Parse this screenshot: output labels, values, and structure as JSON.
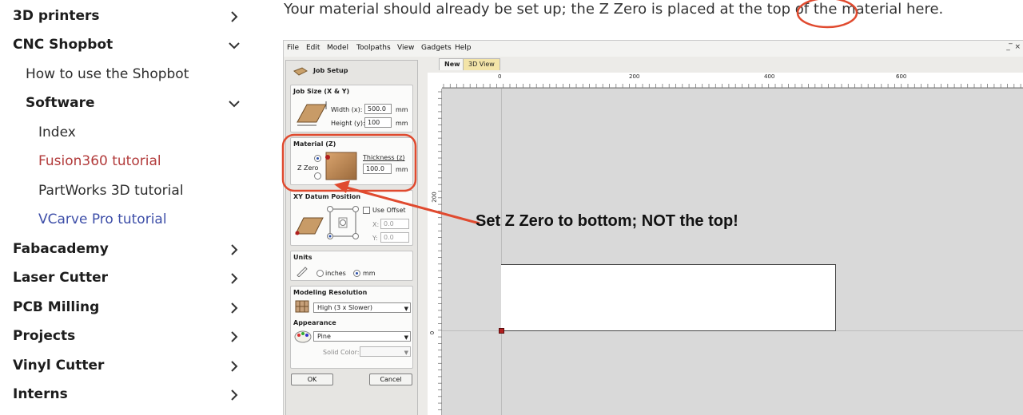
{
  "sidebar": {
    "items": [
      {
        "label": "3D printers",
        "chevron": "chevron-right-icon"
      },
      {
        "label": "CNC Shopbot",
        "chevron": "chevron-down-icon"
      },
      {
        "label": "How to use the Shopbot"
      },
      {
        "label": "Software",
        "chevron": "chevron-down-icon"
      },
      {
        "label": "Index"
      },
      {
        "label": "Fusion360 tutorial"
      },
      {
        "label": "PartWorks 3D tutorial"
      },
      {
        "label": "VCarve Pro tutorial"
      },
      {
        "label": "Fabacademy",
        "chevron": "chevron-right-icon"
      },
      {
        "label": "Laser Cutter",
        "chevron": "chevron-right-icon"
      },
      {
        "label": "PCB Milling",
        "chevron": "chevron-right-icon"
      },
      {
        "label": "Projects",
        "chevron": "chevron-right-icon"
      },
      {
        "label": "Vinyl Cutter",
        "chevron": "chevron-right-icon"
      },
      {
        "label": "Interns",
        "chevron": "chevron-right-icon"
      }
    ]
  },
  "content": {
    "intro": "Your material should already be set up; the Z Zero is placed at the top of the material here."
  },
  "app": {
    "menu": [
      "File",
      "Edit",
      "Model",
      "Toolpaths",
      "View",
      "Gadgets",
      "Help"
    ],
    "window_controls": "_ ̅ ×",
    "tabs": {
      "new": "New",
      "view3d": "3D View"
    },
    "panel": {
      "title": "Job Setup",
      "job_size": {
        "title": "Job Size (X & Y)",
        "width_label": "Width (x):",
        "width_value": "500.0",
        "height_label": "Height (y):",
        "height_value": "100",
        "unit": "mm"
      },
      "material": {
        "title": "Material (Z)",
        "zzero_label": "Z Zero",
        "thickness_label": "Thickness (z)",
        "thickness_value": "100.0",
        "unit": "mm"
      },
      "datum": {
        "title": "XY Datum Position",
        "use_offset": "Use Offset",
        "x_label": "X:",
        "x_value": "0.0",
        "y_label": "Y:",
        "y_value": "0.0"
      },
      "units": {
        "title": "Units",
        "inches": "inches",
        "mm": "mm"
      },
      "resolution": {
        "title": "Modeling Resolution",
        "value": "High (3 x Slower)"
      },
      "appearance": {
        "title": "Appearance",
        "value": "Pine",
        "solid_color_label": "Solid Color:"
      },
      "ok": "OK",
      "cancel": "Cancel"
    },
    "ruler": {
      "top_labels": [
        "0",
        "200",
        "400",
        "600"
      ],
      "left_labels": [
        "200",
        "0"
      ]
    }
  },
  "annotation": {
    "text": "Set Z Zero to bottom; NOT the top!",
    "color": "#e04a2f"
  },
  "colors": {
    "link_red": "#b23b3b",
    "link_blue": "#3d4ea8",
    "annotation_red": "#e04a2f"
  }
}
